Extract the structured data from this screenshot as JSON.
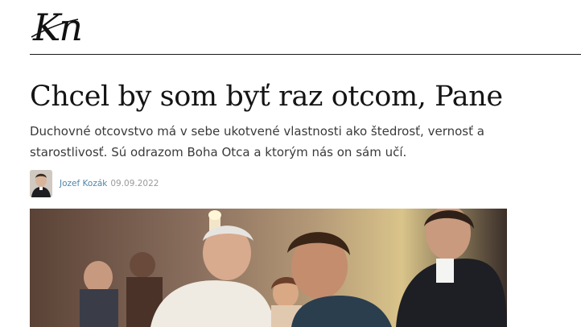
{
  "site": {
    "logo_text": "Kn"
  },
  "article": {
    "title": "Chcel by som byť raz otcom, Pane",
    "perex": "Duchovné otcovstvo má v sebe ukotvené vlastnosti ako štedrosť, vernosť a starostlivosť. Sú odrazom Boha Otca a ktorým nás on sám učí.",
    "author": "Jozef Kozák",
    "date": "09.09.2022"
  },
  "icons": {
    "logo": "kn-logo-icon"
  }
}
